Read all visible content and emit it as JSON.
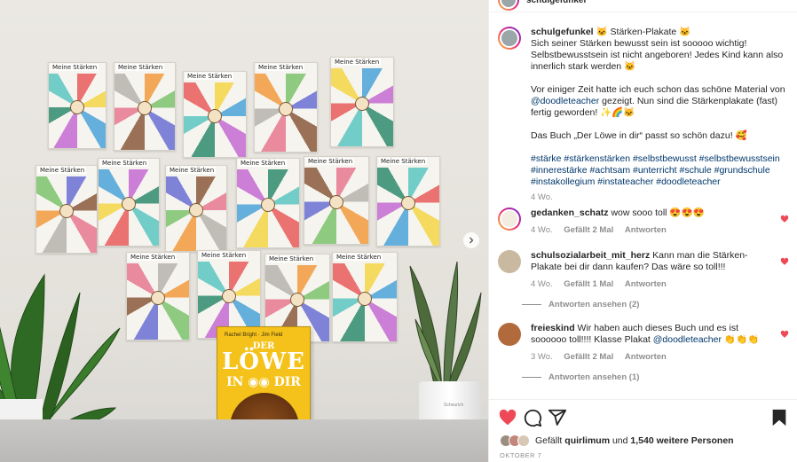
{
  "post": {
    "username": "schulgefunkel",
    "caption": {
      "title": "🐱 Stärken-Plakate 🐱",
      "line1": "Sich seiner Stärken bewusst sein ist sooooo wichtig! Selbstbewusstsein ist nicht angeboren! Jedes Kind kann also innerlich stark werden 🐱",
      "line2_pre": "Vor einiger Zeit hatte ich euch schon das schöne Material von ",
      "line2_mention": "@doodleteacher",
      "line2_post": " gezeigt. Nun sind die Stärkenplakate (fast) fertig geworden! ✨🌈🐱",
      "line3": "Das Buch „Der Löwe in dir“ passt so schön dazu! 🥰",
      "hashtags": "#stärke #stärkenstärken #selbstbewusst #selbstbewusstsein #innerestärke #achtsam #unterricht #schule #grundschule #instakollegium #instateacher #doodleteacher",
      "time": "4 Wo."
    },
    "likes_text_pre": "Gefällt ",
    "likes_user": "quirlimum",
    "likes_mid": " und ",
    "likes_count": "1,540 weitere Personen",
    "date": "OKTOBER 7"
  },
  "photo": {
    "poster_label": "Meine Stärken",
    "book": {
      "author": "Rachel Bright · Jim Field",
      "title_der": "DER",
      "title_loewe": "LÖWE",
      "title_in_dir": "IN ◉◉ DIR"
    },
    "pot_brand": "Scheurich"
  },
  "comments": [
    {
      "user": "gedanken_schatz",
      "text": "wow sooo toll 😍😍😍",
      "time": "4 Wo.",
      "likes": "Gefällt 2 Mal",
      "reply": "Antworten"
    },
    {
      "user": "schulsozialarbeit_mit_herz",
      "text": "Kann man die Stärken-Plakate bei dir dann kaufen? Das wäre so toll!!!",
      "time": "4 Wo.",
      "likes": "Gefällt 1 Mal",
      "reply": "Antworten",
      "view_replies": "Antworten ansehen (2)"
    },
    {
      "user": "freieskind",
      "text_pre": "Wir haben auch dieses Buch und es ist soooooo toll!!!! Klasse Plakat ",
      "mention": "@doodleteacher",
      "text_post": " 👏👏👏",
      "time": "3 Wo.",
      "likes": "Gefällt 2 Mal",
      "reply": "Antworten",
      "view_replies": "Antworten ansehen (1)"
    }
  ],
  "colors": {
    "heart": "#ed4956",
    "link": "#00376b",
    "muted": "#8e8e8e",
    "text": "#262626"
  },
  "icons": [
    "heart-icon",
    "comment-icon",
    "share-icon",
    "bookmark-icon",
    "chevron-right-icon"
  ]
}
